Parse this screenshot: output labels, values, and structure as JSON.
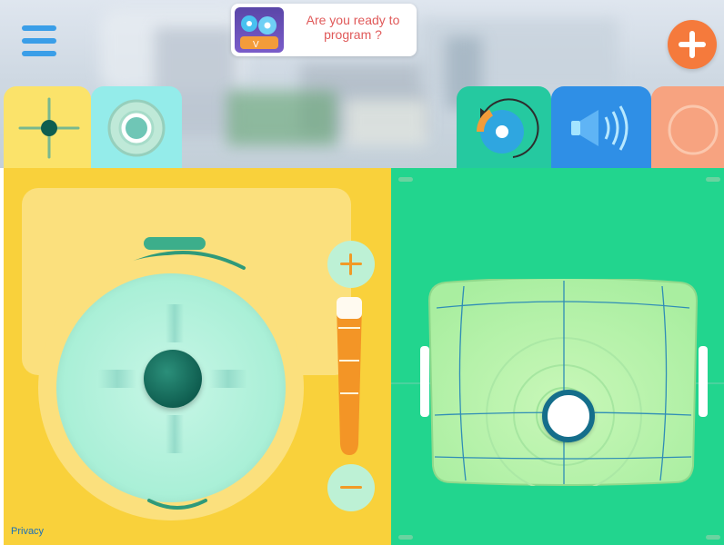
{
  "header": {
    "banner_text": "Are you ready to program ?",
    "menu_icon": "hamburger-icon",
    "add_icon": "plus-icon"
  },
  "tabs": [
    {
      "id": "drive",
      "icon": "drive-crosshair-icon",
      "color": "#fbe36a",
      "selected": true
    },
    {
      "id": "joystick",
      "icon": "joystick-ring-icon",
      "color": "#94ecea"
    },
    {
      "id": "rotate",
      "icon": "rotate-head-icon",
      "color": "#25c9a0"
    },
    {
      "id": "sound",
      "icon": "speaker-icon",
      "color": "#2f8fe6"
    },
    {
      "id": "extra",
      "icon": "circle-icon",
      "color": "#f7a380"
    }
  ],
  "left_panel": {
    "color": "#f9d13b",
    "privacy_label": "Privacy",
    "speed_plus_icon": "plus-icon",
    "speed_minus_icon": "minus-icon"
  },
  "right_panel": {
    "color": "#22d58e"
  }
}
